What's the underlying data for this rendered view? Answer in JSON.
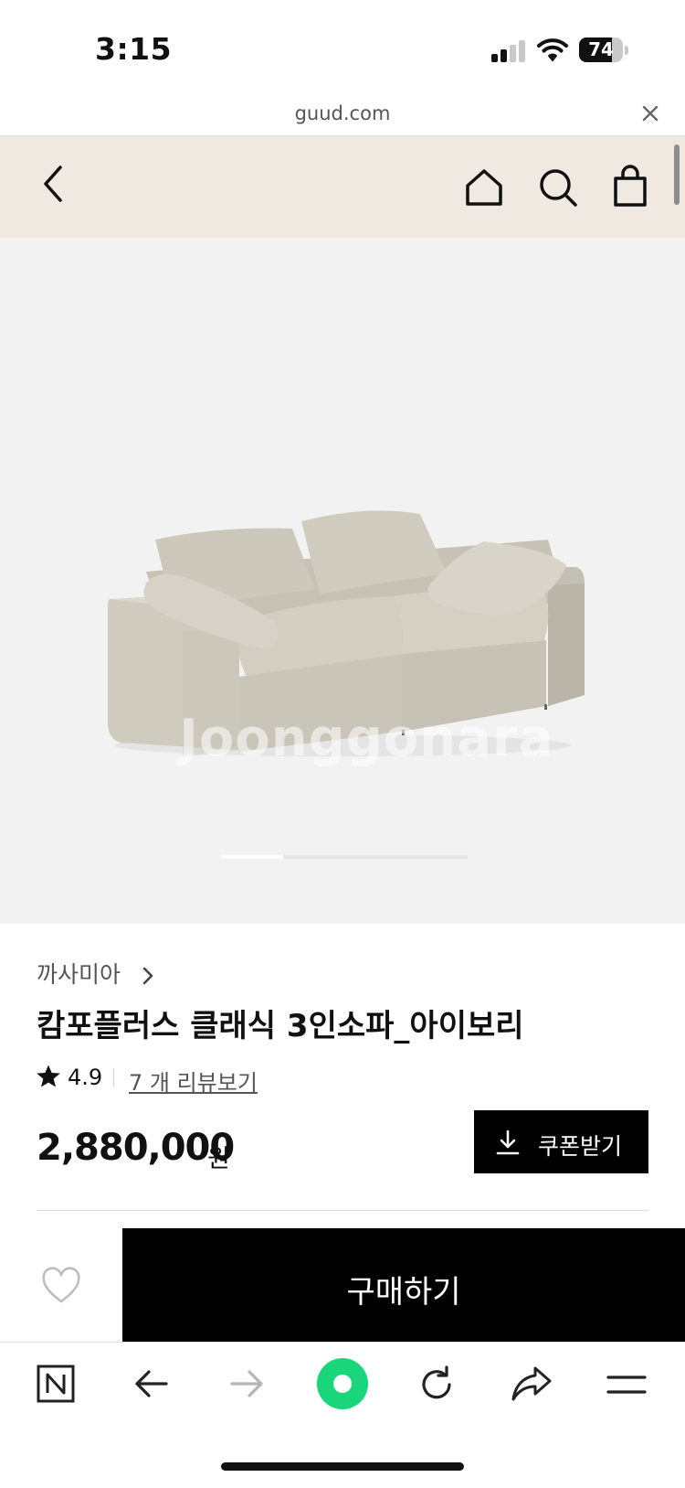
{
  "status_bar": {
    "time": "3:15",
    "battery": "74",
    "battery_level": 0.74,
    "signal_bars_active": 2,
    "signal_bars_total": 4
  },
  "browser": {
    "url": "guud.com"
  },
  "header": {
    "back_icon": "chevron-left-icon",
    "home_icon": "home-icon",
    "search_icon": "search-icon",
    "cart_icon": "shopping-bag-icon",
    "background": "#efe9e1"
  },
  "product": {
    "watermark": "Joonggonara",
    "brand": "까사미아",
    "title": "캄포플러스 클래식 3인소파_아이보리",
    "rating": "4.9",
    "review_link": "7 개 리뷰보기",
    "price": "2,880,000",
    "currency": "원",
    "coupon_button": "쿠폰받기",
    "image_carousel": {
      "current": 1,
      "total": 4
    }
  },
  "purchase_bar": {
    "buy_button": "구매하기",
    "wish_icon": "heart-outline-icon"
  },
  "toolbar": {
    "items": [
      "naver-n-icon",
      "arrow-left-icon",
      "arrow-right-icon",
      "green-dot-icon",
      "refresh-icon",
      "share-icon",
      "menu-icon"
    ]
  },
  "colors": {
    "accent": "#19d67a",
    "primary_button": "#000000",
    "header_bg": "#efe9e1"
  }
}
